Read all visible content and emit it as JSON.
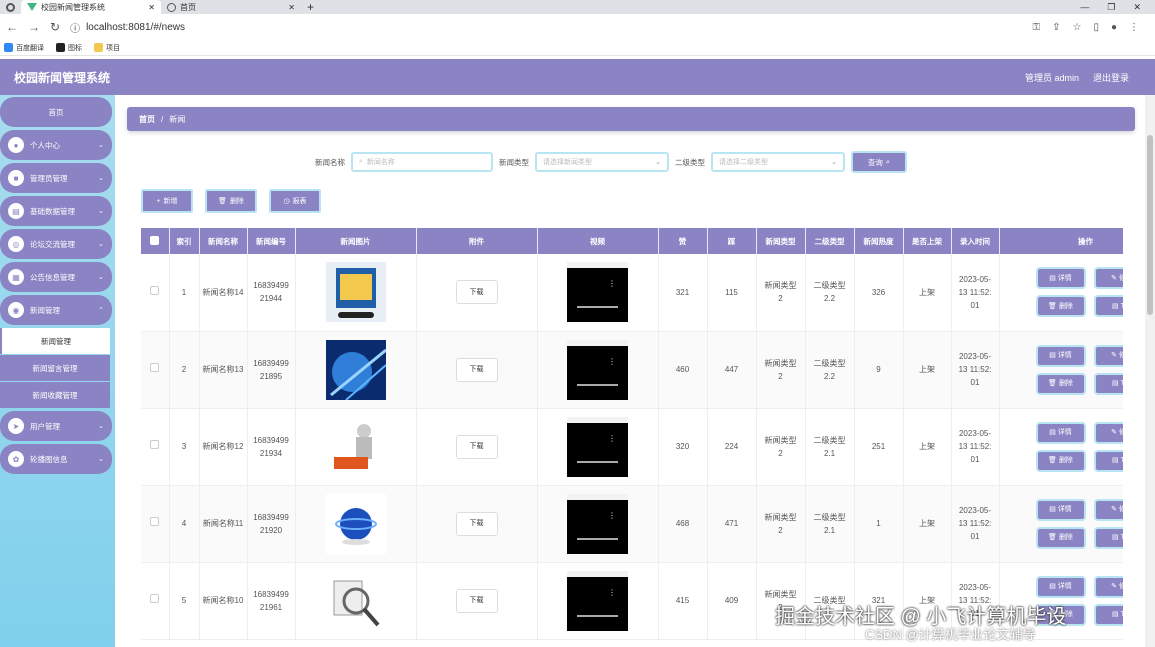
{
  "browser": {
    "tabs": [
      {
        "label": "校园新闻管理系统",
        "active": true
      },
      {
        "label": "首页",
        "active": false
      }
    ],
    "url": "localhost:8081/#/news",
    "bookmarks": [
      "百度翻译",
      "图标",
      "项目"
    ]
  },
  "app": {
    "title": "校园新闻管理系统",
    "user_label": "管理员 admin",
    "logout_label": "退出登录"
  },
  "sidebar": {
    "home": "首页",
    "items": [
      {
        "label": "个人中心",
        "icon": "user-icon"
      },
      {
        "label": "管理员管理",
        "icon": "admin-icon"
      },
      {
        "label": "基础数据管理",
        "icon": "database-icon"
      },
      {
        "label": "论坛交流管理",
        "icon": "forum-icon"
      },
      {
        "label": "公告信息管理",
        "icon": "notice-icon"
      },
      {
        "label": "新闻管理",
        "icon": "news-icon"
      }
    ],
    "sub_items": [
      "新闻管理",
      "新闻留言管理",
      "新闻收藏管理"
    ],
    "items_after": [
      {
        "label": "用户管理",
        "icon": "send-icon"
      },
      {
        "label": "轮播图信息",
        "icon": "carousel-icon"
      }
    ]
  },
  "breadcrumb": {
    "home": "首页",
    "sep": "/",
    "current": "新闻"
  },
  "search": {
    "name_label": "新闻名称",
    "name_placeholder": "新闻名称",
    "type_label": "新闻类型",
    "type_placeholder": "请选择新闻类型",
    "subtype_label": "二级类型",
    "subtype_placeholder": "请选择二级类型",
    "query_label": "查询"
  },
  "toolbar": {
    "add_label": "新增",
    "delete_label": "删除",
    "report_label": "报表"
  },
  "table": {
    "headers": [
      "索引",
      "新闻名称",
      "新闻编号",
      "新闻图片",
      "附件",
      "视频",
      "赞",
      "踩",
      "新闻类型",
      "二级类型",
      "新闻热度",
      "是否上架",
      "录入时间",
      "操作"
    ],
    "download_label": "下载",
    "op_labels": {
      "detail": "详情",
      "edit": "修",
      "delete": "删除",
      "other": "T"
    },
    "rows": [
      {
        "index": "1",
        "name": "新闻名称14",
        "code": "1683949921944",
        "likes": "321",
        "dislikes": "115",
        "type": "新闻类型2",
        "subtype": "二级类型2.2",
        "heat": "326",
        "status": "上架",
        "time": "2023-05-13 11:52:01"
      },
      {
        "index": "2",
        "name": "新闻名称13",
        "code": "1683949921895",
        "likes": "460",
        "dislikes": "447",
        "type": "新闻类型2",
        "subtype": "二级类型2.2",
        "heat": "9",
        "status": "上架",
        "time": "2023-05-13 11:52:01"
      },
      {
        "index": "3",
        "name": "新闻名称12",
        "code": "1683949921934",
        "likes": "320",
        "dislikes": "224",
        "type": "新闻类型2",
        "subtype": "二级类型2.1",
        "heat": "251",
        "status": "上架",
        "time": "2023-05-13 11:52:01"
      },
      {
        "index": "4",
        "name": "新闻名称11",
        "code": "1683949921920",
        "likes": "468",
        "dislikes": "471",
        "type": "新闻类型2",
        "subtype": "二级类型2.1",
        "heat": "1",
        "status": "上架",
        "time": "2023-05-13 11:52:01"
      },
      {
        "index": "5",
        "name": "新闻名称10",
        "code": "1683949921961",
        "likes": "415",
        "dislikes": "409",
        "type": "新闻类型2",
        "subtype": "二级类型",
        "heat": "321",
        "status": "上架",
        "time": "2023-05-13 11:52:01"
      }
    ]
  },
  "watermark": {
    "line1": "掘金技术社区 @ 小飞计算机毕设",
    "line2": "CSDN @计算机毕业论文辅导"
  },
  "colors": {
    "primary": "#8b84c4",
    "sidebar": "#a9dcef",
    "border_accent": "#b9e4f2"
  }
}
